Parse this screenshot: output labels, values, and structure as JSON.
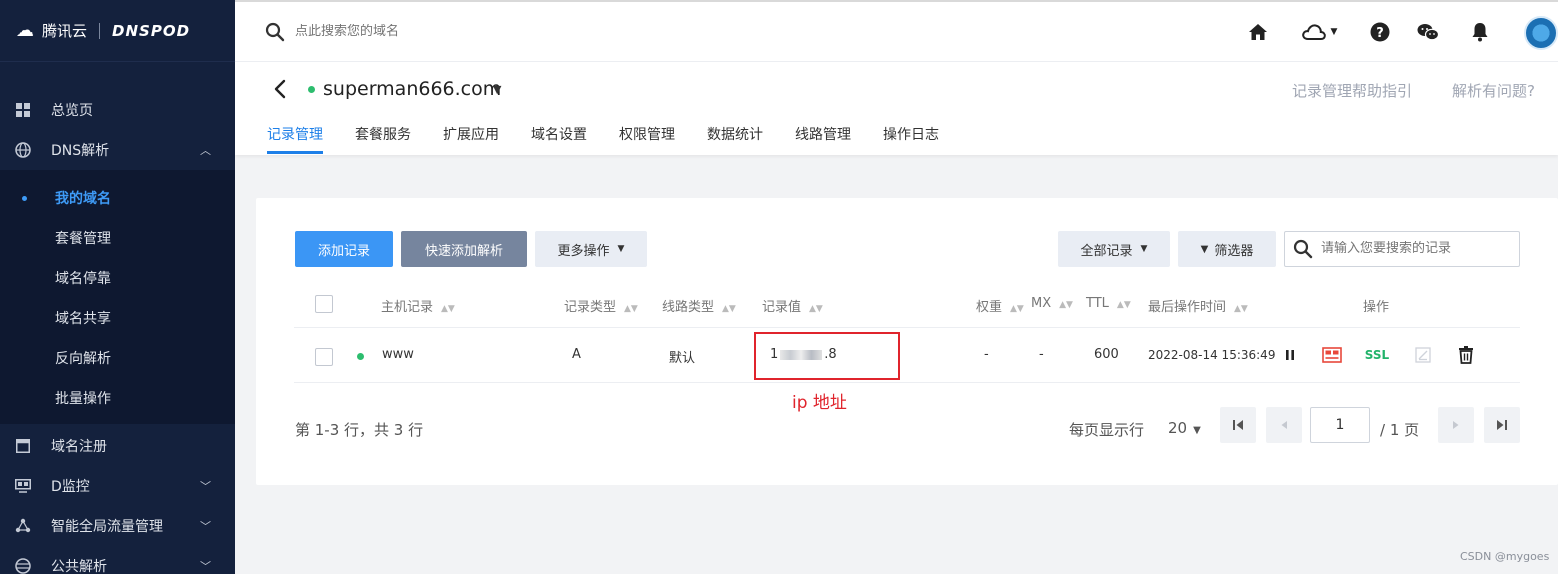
{
  "brand": {
    "name": "腾讯云",
    "product": "DNSPOD"
  },
  "sidebar": {
    "items": [
      {
        "label": "总览页",
        "icon": "grid-icon"
      },
      {
        "label": "DNS解析",
        "icon": "globe-icon",
        "chevron": "up"
      },
      {
        "label": "域名注册",
        "icon": "window-icon"
      },
      {
        "label": "D监控",
        "icon": "monitor-icon",
        "chevron": "down"
      },
      {
        "label": "智能全局流量管理",
        "icon": "network-icon",
        "chevron": "down"
      },
      {
        "label": "公共解析",
        "icon": "globe-lines-icon",
        "chevron": "down"
      }
    ],
    "subitems": [
      {
        "label": "我的域名",
        "active": true
      },
      {
        "label": "套餐管理"
      },
      {
        "label": "域名停靠"
      },
      {
        "label": "域名共享"
      },
      {
        "label": "反向解析"
      },
      {
        "label": "批量操作"
      }
    ]
  },
  "topbar": {
    "search_placeholder": "点此搜索您的域名",
    "icons": [
      "home-icon",
      "cloud-icon",
      "help-icon",
      "wechat-icon",
      "bell-icon"
    ]
  },
  "domain": {
    "name": "superman666.com",
    "status_color": "#2dbd6e",
    "help_links": [
      "记录管理帮助指引",
      "解析有问题?"
    ],
    "tabs": [
      "记录管理",
      "套餐服务",
      "扩展应用",
      "域名设置",
      "权限管理",
      "数据统计",
      "线路管理",
      "操作日志"
    ],
    "active_tab": 0
  },
  "toolbar": {
    "add_record": "添加记录",
    "quick_add": "快速添加解析",
    "more_ops": "更多操作",
    "all_records": "全部记录",
    "filter": "筛选器",
    "search_placeholder": "请输入您要搜索的记录"
  },
  "table": {
    "columns": [
      "主机记录",
      "记录类型",
      "线路类型",
      "记录值",
      "权重",
      "MX",
      "TTL",
      "最后操作时间",
      "操作"
    ],
    "rows": [
      {
        "host": "www",
        "type": "A",
        "line": "默认",
        "value_prefix": "1",
        "value_suffix": ".8",
        "weight": "-",
        "mx": "-",
        "ttl": "600",
        "updated": "2022-08-14 15:36:49"
      }
    ],
    "ssl_label": "SSL"
  },
  "annotation": {
    "note": "ip 地址",
    "color": "#e0242c"
  },
  "pagination": {
    "summary": "第 1-3 行，共 3 行",
    "per_page_label": "每页显示行",
    "per_page": "20",
    "current_page": "1",
    "total_pages": "/ 1 页"
  },
  "watermark": "CSDN @mygoes"
}
